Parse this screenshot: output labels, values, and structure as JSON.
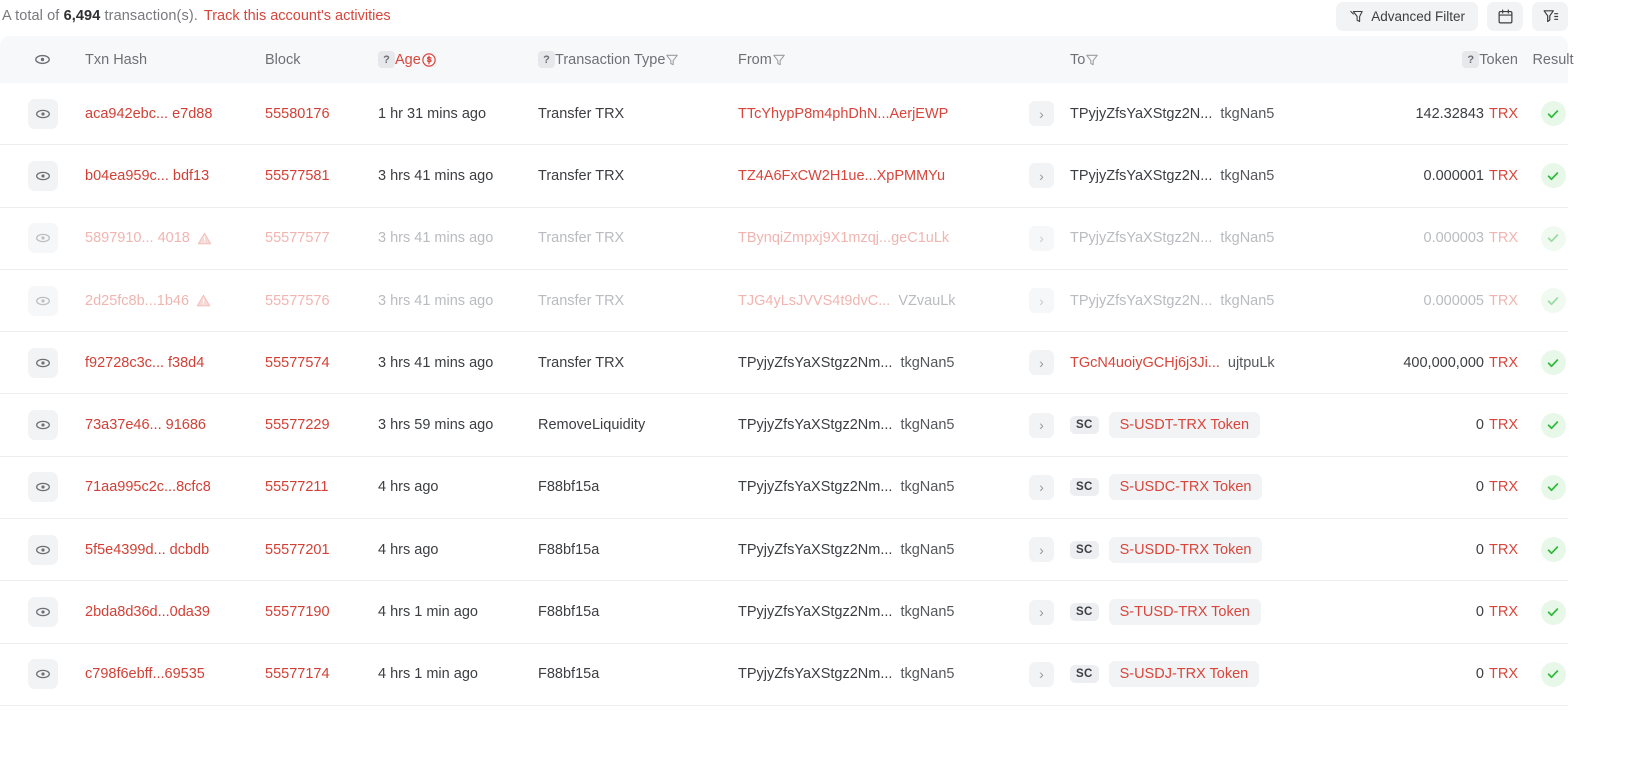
{
  "header": {
    "total_prefix": "A total of",
    "total_count": "6,494",
    "total_suffix": "transaction(s).",
    "track_link": "Track this account's activities",
    "advanced_filter_label": "Advanced Filter",
    "calendar_icon": "calendar-icon",
    "filter_list_icon": "filter-list-icon",
    "filter_icon": "filter-icon"
  },
  "columns": {
    "eye": "eye-icon",
    "txn_hash": "Txn Hash",
    "block": "Block",
    "age": "Age",
    "age_toggle_icon": "swap-time-icon",
    "transaction_type": "Transaction Type",
    "from": "From",
    "to": "To",
    "token": "Token",
    "result": "Result",
    "help_icon": "?",
    "filter_icon": "filter-icon"
  },
  "colors": {
    "accent_red": "#d8453b",
    "link_red": "#d14036",
    "text_dark": "#3c3e42",
    "text_gray": "#6e7075",
    "header_bg": "#f7f8fa",
    "chip_bg": "#f2f3f5",
    "success_green": "#2eb83a",
    "success_bg": "#e7f7e8",
    "faded_red": "#f0b5b0",
    "faded_gray": "#b9bbbf"
  },
  "rows": [
    {
      "hash": "aca942ebc... e7d88",
      "warning": false,
      "block": "55580176",
      "age": "1 hr 31 mins ago",
      "type": "Transfer TRX",
      "from_addr": "TTcYhypP8m4phDhN...AerjEWP",
      "from_tail": "",
      "from_red": true,
      "to_kind": "address",
      "to_addr": "TPyjyZfsYaXStgz2N...",
      "to_tail": "tkgNan5",
      "to_red": false,
      "amount": "142.32843",
      "symbol": "TRX",
      "result": "success",
      "faded": false
    },
    {
      "hash": "b04ea959c... bdf13",
      "warning": false,
      "block": "55577581",
      "age": "3 hrs 41 mins ago",
      "type": "Transfer TRX",
      "from_addr": "TZ4A6FxCW2H1ue...XpPMMYu",
      "from_tail": "",
      "from_red": true,
      "to_kind": "address",
      "to_addr": "TPyjyZfsYaXStgz2N...",
      "to_tail": "tkgNan5",
      "to_red": false,
      "amount": "0.000001",
      "symbol": "TRX",
      "result": "success",
      "faded": false
    },
    {
      "hash": "5897910... 4018",
      "warning": true,
      "block": "55577577",
      "age": "3 hrs 41 mins ago",
      "type": "Transfer TRX",
      "from_addr": "TBynqiZmpxj9X1mzqj...geC1uLk",
      "from_tail": "",
      "from_red": true,
      "to_kind": "address",
      "to_addr": "TPyjyZfsYaXStgz2N...",
      "to_tail": "tkgNan5",
      "to_red": false,
      "amount": "0.000003",
      "symbol": "TRX",
      "result": "success",
      "faded": true
    },
    {
      "hash": "2d25fc8b...1b46",
      "warning": true,
      "block": "55577576",
      "age": "3 hrs 41 mins ago",
      "type": "Transfer TRX",
      "from_addr": "TJG4yLsJVVS4t9dvC...",
      "from_tail": "VZvauLk",
      "from_red": true,
      "to_kind": "address",
      "to_addr": "TPyjyZfsYaXStgz2N...",
      "to_tail": "tkgNan5",
      "to_red": false,
      "amount": "0.000005",
      "symbol": "TRX",
      "result": "success",
      "faded": true
    },
    {
      "hash": "f92728c3c...  f38d4",
      "warning": false,
      "block": "55577574",
      "age": "3 hrs 41 mins ago",
      "type": "Transfer TRX",
      "from_addr": "TPyjyZfsYaXStgz2Nm...",
      "from_tail": "tkgNan5",
      "from_red": false,
      "to_kind": "address",
      "to_addr": "TGcN4uoiyGCHj6j3Ji...",
      "to_tail": "ujtpuLk",
      "to_red": true,
      "amount": "400,000,000",
      "symbol": "TRX",
      "result": "success",
      "faded": false
    },
    {
      "hash": "73a37e46... 91686",
      "warning": false,
      "block": "55577229",
      "age": "3 hrs 59 mins ago",
      "type": "RemoveLiquidity",
      "from_addr": "TPyjyZfsYaXStgz2Nm...",
      "from_tail": "tkgNan5",
      "from_red": false,
      "to_kind": "contract",
      "to_badge": "SC",
      "to_token": "S-USDT-TRX Token",
      "amount": "0",
      "symbol": "TRX",
      "result": "success",
      "faded": false
    },
    {
      "hash": "71aa995c2c...8cfc8",
      "warning": false,
      "block": "55577211",
      "age": "4 hrs ago",
      "type": "F88bf15a",
      "from_addr": "TPyjyZfsYaXStgz2Nm...",
      "from_tail": "tkgNan5",
      "from_red": false,
      "to_kind": "contract",
      "to_badge": "SC",
      "to_token": "S-USDC-TRX Token",
      "amount": "0",
      "symbol": "TRX",
      "result": "success",
      "faded": false
    },
    {
      "hash": "5f5e4399d... dcbdb",
      "warning": false,
      "block": "55577201",
      "age": "4 hrs ago",
      "type": "F88bf15a",
      "from_addr": "TPyjyZfsYaXStgz2Nm...",
      "from_tail": "tkgNan5",
      "from_red": false,
      "to_kind": "contract",
      "to_badge": "SC",
      "to_token": "S-USDD-TRX Token",
      "amount": "0",
      "symbol": "TRX",
      "result": "success",
      "faded": false
    },
    {
      "hash": "2bda8d36d...0da39",
      "warning": false,
      "block": "55577190",
      "age": "4 hrs 1 min ago",
      "type": "F88bf15a",
      "from_addr": "TPyjyZfsYaXStgz2Nm...",
      "from_tail": "tkgNan5",
      "from_red": false,
      "to_kind": "contract",
      "to_badge": "SC",
      "to_token": "S-TUSD-TRX Token",
      "amount": "0",
      "symbol": "TRX",
      "result": "success",
      "faded": false
    },
    {
      "hash": "c798f6ebff...69535",
      "warning": false,
      "block": "55577174",
      "age": "4 hrs 1 min ago",
      "type": "F88bf15a",
      "from_addr": "TPyjyZfsYaXStgz2Nm...",
      "from_tail": "tkgNan5",
      "from_red": false,
      "to_kind": "contract",
      "to_badge": "SC",
      "to_token": "S-USDJ-TRX Token",
      "amount": "0",
      "symbol": "TRX",
      "result": "success",
      "faded": false
    }
  ]
}
